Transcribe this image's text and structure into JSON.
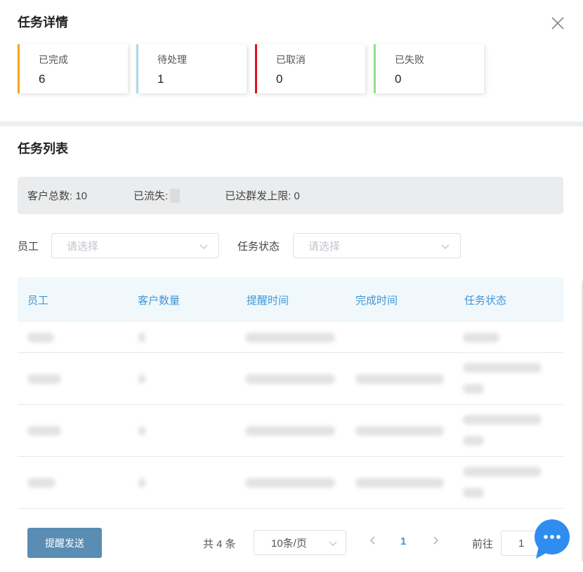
{
  "header": {
    "title": "任务详情"
  },
  "stats": [
    {
      "label": "已完成",
      "value": "6",
      "color": "#f5a623"
    },
    {
      "label": "待处理",
      "value": "1",
      "color": "#a8d8ea"
    },
    {
      "label": "已取消",
      "value": "0",
      "color": "#e8101e"
    },
    {
      "label": "已失败",
      "value": "0",
      "color": "#94e08e"
    }
  ],
  "list": {
    "title": "任务列表"
  },
  "summary": {
    "total_customers": "客户总数: 10",
    "lost": "已流失:",
    "limit": "已达群发上限: 0"
  },
  "filters": {
    "employee_label": "员工",
    "employee_placeholder": "请选择",
    "status_label": "任务状态",
    "status_placeholder": "请选择"
  },
  "table": {
    "columns": [
      "员工",
      "客户数量",
      "提醒时间",
      "完成时间",
      "任务状态"
    ]
  },
  "footer": {
    "remind_button": "提醒发送",
    "total": "共 4 条",
    "page_size": "10条/页",
    "current_page": "1",
    "goto_label": "前往",
    "goto_value": "1"
  },
  "colors": {
    "accent": "#3f96d6",
    "button": "#5a8db3",
    "chat": "#2f8df0"
  }
}
